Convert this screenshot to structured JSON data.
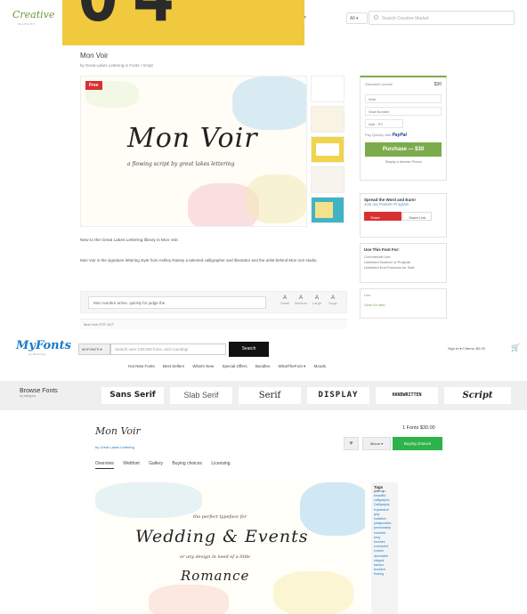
{
  "badge": {
    "text": "04"
  },
  "creative_market": {
    "logo": "Creative",
    "logo_sub": "MARKET",
    "search_scope": "All",
    "search_placeholder": "Search Creative Market",
    "product_title": "Mon Voir",
    "byline": "by Great Lakes Lettering in Fonts / Script",
    "free_badge": "Free",
    "preview_script": "Mon Voir",
    "preview_tagline": "a flowing script by great lakes lettering",
    "desc1": "New to the Great Lakes Lettering library is Mon Voir.",
    "desc2": "Mon Voir is the signature lettering style from Ashley Rainey a talented calligrapher and illustrator and the artist behind Mon Voir studio.",
    "preview_input": "Mon nombre arrive, quickly for judge the",
    "sizes": [
      "Small",
      "Medium",
      "Large",
      "Huge"
    ],
    "bottom_row": "Mon Voir OTF 24/7",
    "sidebar": {
      "license": "Standard License",
      "price": "$30",
      "row1": "Web",
      "row2": "Seat Number",
      "row3": "Add - PC",
      "paypal_text": "Pay Quickly with",
      "paypal_brand": "PayPal",
      "buy": "Purchase — $30",
      "license_link": "Simply a license Prices",
      "share_title": "Spread the Word and Earn!",
      "share_sub": "Join our Partner Program",
      "share_btn": "Share",
      "share_more": "Share Link",
      "use_title": "Use This Font For:",
      "use_items": [
        "Commercial Use",
        "Unlimited Number of Projects",
        "Unlimited End Products for Sale"
      ],
      "like": "Like",
      "collect": "Save for later"
    }
  },
  "myfonts": {
    "logo": "MyFonts",
    "logo_sub": "by Monotype",
    "search_scope": "MYFONTS ▾",
    "search_placeholder": "Search over 130,000 fonts, and counting!",
    "search_button": "Search",
    "top_right": "Sign in ▾  0 Items, $0.00",
    "cart_icon": "🛒",
    "nav": [
      "Hot New Fonts",
      "Best Sellers",
      "What's New",
      "Special Offers",
      "Bundles",
      "WhatTheFont ▾",
      "Moods"
    ],
    "browse_label": "Browse Fonts",
    "browse_sub": "by category",
    "categories": [
      "Sans Serif",
      "Slab Serif",
      "Serif",
      "DISPLAY",
      "HANDWRITTEN",
      "Script"
    ],
    "font_title": "Mon Voir",
    "by": "by Great Lakes Lettering",
    "tabs": [
      "Overview",
      "Webfont",
      "Gallery",
      "Buying choices",
      "Licensing"
    ],
    "fonts_price": "1 Fonts $30.00",
    "heart": "♥",
    "album": "Album ▾",
    "buy": "Buying choices",
    "preview_small1": "the perfect typeface for",
    "preview_big1": "Wedding & Events",
    "preview_small2": "or any design in need of a little",
    "preview_big2": "Romance",
    "tags_heading": "Tags",
    "tags_sub": "(with up...",
    "tags": [
      "beautiful",
      "calligraphic",
      "Calligraphy",
      "expressive",
      "girly",
      "invitation",
      "juxtaposition",
      "penmanship",
      "romantic",
      "sexy",
      "brushes",
      "connected",
      "cursive",
      "decorative",
      "elegant",
      "fashion",
      "feminine",
      "flowing"
    ]
  }
}
